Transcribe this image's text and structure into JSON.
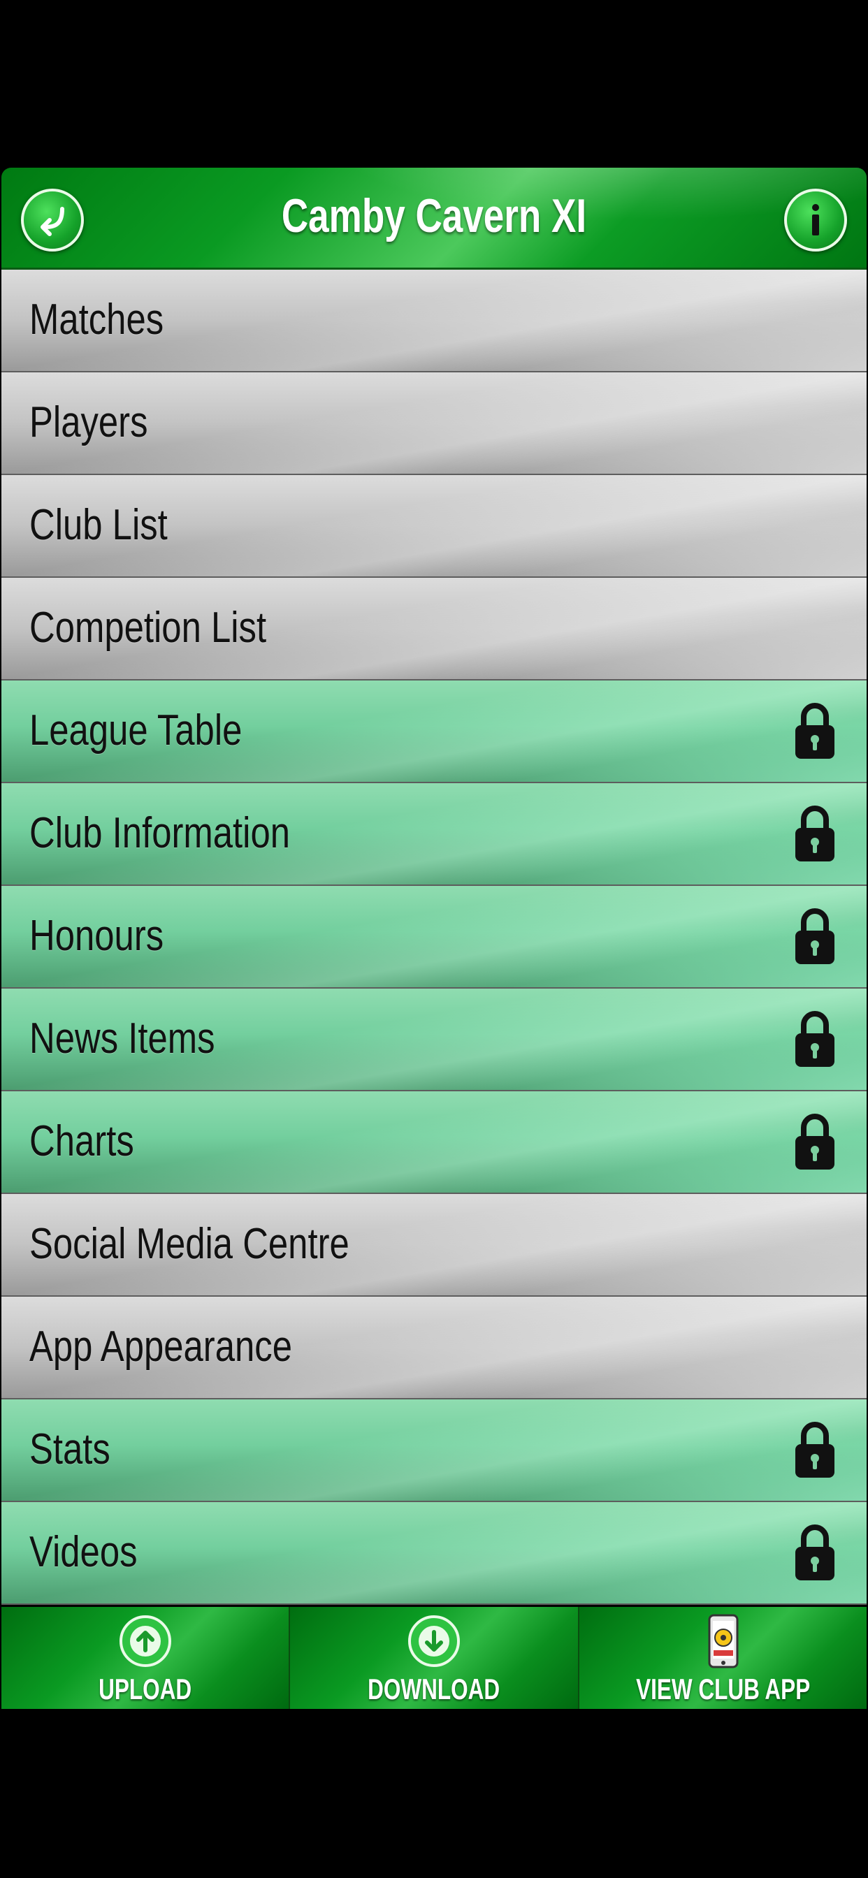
{
  "header": {
    "title": "Camby Cavern XI",
    "back_icon": "back-arrow-icon",
    "info_icon": "info-icon"
  },
  "menu": {
    "items": [
      {
        "label": "Matches",
        "style": "grey",
        "locked": false
      },
      {
        "label": "Players",
        "style": "grey",
        "locked": false
      },
      {
        "label": "Club List",
        "style": "grey",
        "locked": false
      },
      {
        "label": "Competion List",
        "style": "grey",
        "locked": false
      },
      {
        "label": "League Table",
        "style": "green",
        "locked": true
      },
      {
        "label": "Club Information",
        "style": "green",
        "locked": true
      },
      {
        "label": "Honours",
        "style": "green",
        "locked": true
      },
      {
        "label": "News Items",
        "style": "green",
        "locked": true
      },
      {
        "label": "Charts",
        "style": "green",
        "locked": true
      },
      {
        "label": "Social Media Centre",
        "style": "grey",
        "locked": false
      },
      {
        "label": "App Appearance",
        "style": "grey",
        "locked": false
      },
      {
        "label": "Stats",
        "style": "green",
        "locked": true
      },
      {
        "label": "Videos",
        "style": "green",
        "locked": true
      }
    ]
  },
  "footer": {
    "upload_label": "UPLOAD",
    "download_label": "DOWNLOAD",
    "view_club_app_label": "VIEW CLUB APP"
  },
  "colors": {
    "header_green": "#0a9a22",
    "row_grey": "#c3c3c3",
    "row_green": "#73cf9e"
  }
}
